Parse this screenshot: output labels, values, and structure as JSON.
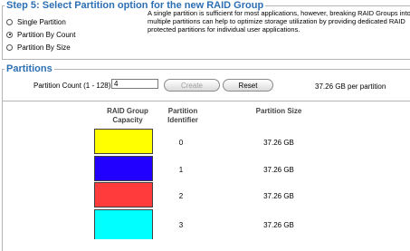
{
  "step": {
    "title": "Step 5: Select Partition option for the new RAID Group",
    "options": [
      {
        "label": "Single Partition",
        "checked": false
      },
      {
        "label": "Partition By Count",
        "checked": true
      },
      {
        "label": "Partition By Size",
        "checked": false
      }
    ],
    "description": "A single partition is sufficient for most applications, however, breaking RAID Groups into multiple partitions can help to optimize storage utilization by providing dedicated RAID protected partitions for individual user applications."
  },
  "partitions": {
    "title": "Partitions",
    "count_label": "Partition Count (1 - 128) :",
    "count_value": "4",
    "create_label": "Create",
    "reset_label": "Reset",
    "per_partition": "37.26 GB per partition",
    "headers": {
      "capacity": "RAID Group Capacity",
      "identifier": "Partition Identifier",
      "size": "Partition Size"
    },
    "rows": [
      {
        "id": "0",
        "size": "37.26 GB",
        "color": "#ffff00"
      },
      {
        "id": "1",
        "size": "37.26 GB",
        "color": "#2200ff"
      },
      {
        "id": "2",
        "size": "37.26 GB",
        "color": "#ff3b3b"
      },
      {
        "id": "3",
        "size": "37.26 GB",
        "color": "#00ffff"
      }
    ]
  }
}
